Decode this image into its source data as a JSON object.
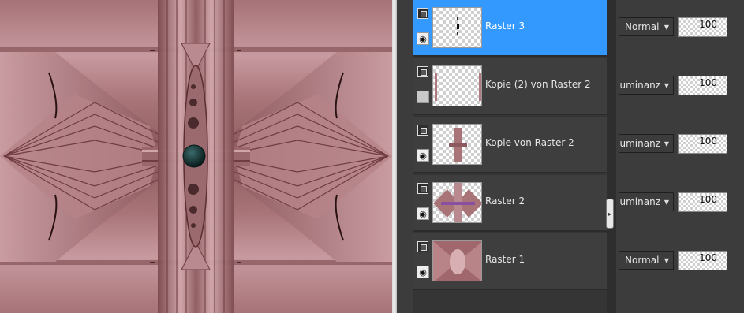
{
  "canvas": {
    "description_colors": {
      "rose_light": "#c79aa0",
      "rose_mid": "#a87478",
      "rose_dark": "#6e3f43",
      "center_gem": "#0f2a2a"
    }
  },
  "layers": [
    {
      "name": "Raster 3",
      "selected": true,
      "visible": true,
      "blend_mode": "Normal",
      "opacity": "100"
    },
    {
      "name": "Kopie (2) von Raster 2",
      "selected": false,
      "visible": false,
      "blend_mode": "uminanz (\\",
      "opacity": "100"
    },
    {
      "name": "Kopie von Raster 2",
      "selected": false,
      "visible": true,
      "blend_mode": "uminanz (\\",
      "opacity": "100"
    },
    {
      "name": "Raster 2",
      "selected": false,
      "visible": true,
      "blend_mode": "uminanz (\\",
      "opacity": "100"
    },
    {
      "name": "Raster 1",
      "selected": false,
      "visible": true,
      "blend_mode": "Normal",
      "opacity": "100"
    }
  ],
  "colors": {
    "selected": "#3399ff",
    "row": "#3e3e3e",
    "panel": "#3c3c3c"
  },
  "icons": {
    "lock": "layer-lock-icon",
    "visibility": "eye-icon",
    "dropdown": "chevron-down-icon",
    "collapse": "panel-collapse-icon"
  }
}
